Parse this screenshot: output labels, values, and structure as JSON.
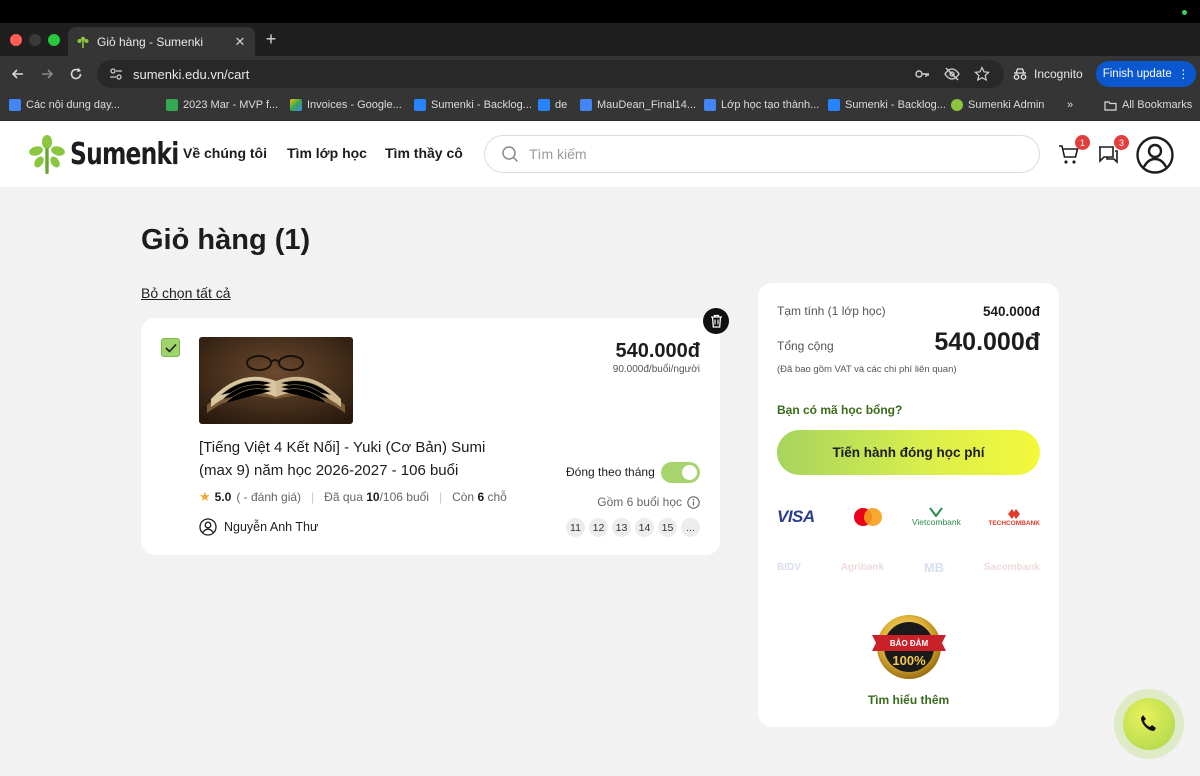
{
  "browser": {
    "tab_title": "Giỏ hàng - Sumenki",
    "url": "sumenki.edu.vn/cart",
    "incognito_label": "Incognito",
    "finish_update_label": "Finish update",
    "bookmarks": [
      "Các nội dung dạy...",
      "2023 Mar - MVP f...",
      "Invoices - Google...",
      "Sumenki - Backlog...",
      "de",
      "MauDean_Final14...",
      "Lớp học tạo thành...",
      "Sumenki - Backlog...",
      "Sumenki Admin"
    ],
    "bookmarks_overflow": "»",
    "all_bookmarks_label": "All Bookmarks"
  },
  "header": {
    "logo_text": "Sumenki",
    "nav": [
      "Về chúng tôi",
      "Tìm lớp học",
      "Tìm thầy cô"
    ],
    "search_placeholder": "Tìm kiếm",
    "cart_badge": "1",
    "chat_badge": "3"
  },
  "page": {
    "title": "Giỏ hàng (1)",
    "deselect_all": "Bỏ chọn tất cả"
  },
  "cart_item": {
    "price": "540.000đ",
    "unit_price": "90.000đ/buổi/người",
    "title": "[Tiếng Việt 4 Kết Nối] - Yuki (Cơ Bản) Sumi (max 9) năm học 2026-2027 - 106 buổi",
    "rating": "5.0",
    "rating_note": "( - đánh giá)",
    "progress_prefix": "Đã qua",
    "progress_done": "10",
    "progress_total": "/106 buổi",
    "remaining_prefix": "Còn",
    "remaining_count": "6",
    "remaining_suffix": "chỗ",
    "teacher": "Nguyễn Anh Thư",
    "monthly_label": "Đóng theo tháng",
    "monthly_enabled": true,
    "sessions_note": "Gồm 6 buổi học",
    "session_chips": [
      "11",
      "12",
      "13",
      "14",
      "15",
      "..."
    ]
  },
  "summary": {
    "subtotal_label": "Tạm tính (1 lớp học)",
    "subtotal_value": "540.000đ",
    "total_label": "Tổng cộng",
    "total_value": "540.000đ",
    "vat_note": "(Đã bao gồm VAT và các chi phí liên quan)",
    "scholarship_link": "Bạn có mã học bổng?",
    "pay_button": "Tiến hành đóng học phí",
    "payment_methods": [
      "VISA",
      "Mastercard",
      "Vietcombank",
      "TECHCOMBANK"
    ],
    "payment_methods_faint": [
      "BIDV",
      "Agribank",
      "MB",
      "Sacombank"
    ],
    "seal_top": "BẢO ĐẢM",
    "seal_bottom": "100%",
    "learn_more": "Tìm hiểu thêm"
  },
  "colors": {
    "accent_green": "#9fd36b",
    "pay_gradient_start": "#a6d45e",
    "pay_gradient_end": "#f4f83a",
    "badge_red": "#e43d3d",
    "link_green": "#3a6b1a"
  }
}
